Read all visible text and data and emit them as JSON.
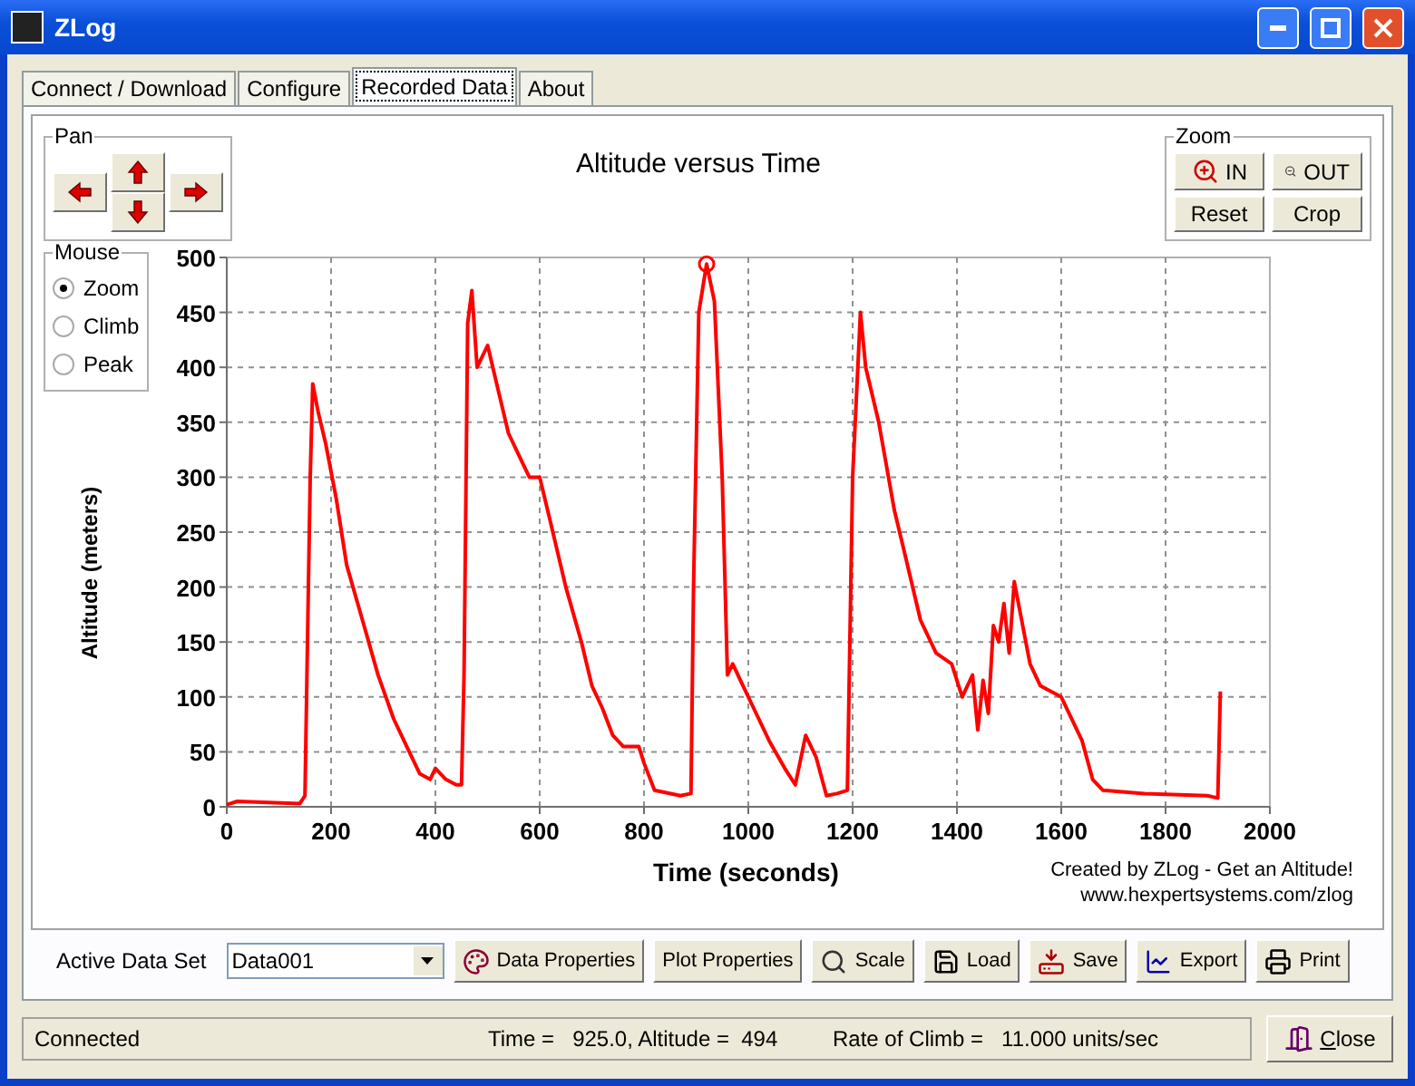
{
  "window": {
    "title": "ZLog"
  },
  "tabs": [
    {
      "label": "Connect / Download",
      "selected": false
    },
    {
      "label": "Configure",
      "selected": false
    },
    {
      "label": "Recorded Data",
      "selected": true
    },
    {
      "label": "About",
      "selected": false
    }
  ],
  "pan": {
    "title": "Pan"
  },
  "zoom": {
    "title": "Zoom",
    "buttons": [
      {
        "kind": "zoom-in",
        "label": "IN"
      },
      {
        "kind": "zoom-out",
        "label": "OUT"
      },
      {
        "kind": "plain",
        "label": "Reset"
      },
      {
        "kind": "plain",
        "label": "Crop"
      }
    ]
  },
  "mouse": {
    "title": "Mouse",
    "options": [
      {
        "label": "Zoom",
        "selected": true
      },
      {
        "label": "Climb",
        "selected": false
      },
      {
        "label": "Peak",
        "selected": false
      }
    ]
  },
  "credits": [
    "Created by ZLog - Get an Altitude!",
    "www.hexpertsystems.com/zlog"
  ],
  "chart_data": {
    "type": "line",
    "title": "Altitude versus Time",
    "xlabel": "Time (seconds)",
    "ylabel": "Altitude (meters)",
    "x": [
      0,
      20,
      140,
      150,
      160,
      165,
      175,
      190,
      210,
      230,
      260,
      290,
      320,
      350,
      370,
      390,
      400,
      420,
      440,
      450,
      455,
      462,
      470,
      480,
      500,
      520,
      540,
      560,
      580,
      600,
      620,
      650,
      680,
      700,
      720,
      740,
      760,
      790,
      800,
      820,
      870,
      890,
      895,
      905,
      920,
      935,
      950,
      960,
      970,
      990,
      1010,
      1040,
      1070,
      1090,
      1110,
      1130,
      1150,
      1170,
      1190,
      1200,
      1215,
      1225,
      1250,
      1280,
      1300,
      1330,
      1360,
      1390,
      1410,
      1430,
      1440,
      1450,
      1460,
      1470,
      1480,
      1490,
      1500,
      1510,
      1520,
      1540,
      1560,
      1600,
      1640,
      1660,
      1680,
      1760,
      1880,
      1900,
      1905
    ],
    "series": [
      {
        "color": "#ff0000",
        "values": [
          2,
          5,
          3,
          10,
          300,
          385,
          360,
          330,
          280,
          220,
          170,
          120,
          80,
          50,
          30,
          25,
          35,
          25,
          20,
          20,
          120,
          440,
          470,
          400,
          420,
          380,
          340,
          320,
          300,
          300,
          260,
          200,
          150,
          110,
          90,
          65,
          55,
          55,
          40,
          15,
          10,
          12,
          200,
          450,
          494,
          460,
          300,
          120,
          130,
          110,
          90,
          60,
          35,
          20,
          65,
          45,
          10,
          12,
          15,
          300,
          450,
          400,
          350,
          270,
          230,
          170,
          140,
          130,
          100,
          120,
          70,
          115,
          85,
          165,
          150,
          185,
          140,
          205,
          180,
          130,
          110,
          100,
          60,
          25,
          15,
          12,
          10,
          8,
          105
        ]
      }
    ],
    "xlim": [
      0,
      2000
    ],
    "ylim": [
      0,
      500
    ],
    "xticks": [
      0,
      200,
      400,
      600,
      800,
      1000,
      1200,
      1400,
      1600,
      1800,
      2000
    ],
    "yticks": [
      0,
      50,
      100,
      150,
      200,
      250,
      300,
      350,
      400,
      450,
      500
    ],
    "grid": true
  },
  "toolbar": {
    "dataset_label": "Active Data Set",
    "dataset_value": "Data001",
    "buttons": [
      {
        "kind": "data-properties",
        "label": "Data Properties"
      },
      {
        "kind": "plain",
        "label": "Plot Properties"
      },
      {
        "kind": "scale",
        "label": "Scale"
      },
      {
        "kind": "load",
        "label": "Load"
      },
      {
        "kind": "save",
        "label": "Save"
      },
      {
        "kind": "export",
        "label": "Export"
      },
      {
        "kind": "print",
        "label": "Print"
      }
    ]
  },
  "status_bar": {
    "connection": "Connected",
    "position": "Time =   925.0, Altitude =  494",
    "climb": "Rate of Climb =   11.000 units/sec",
    "close_button": "Close"
  }
}
